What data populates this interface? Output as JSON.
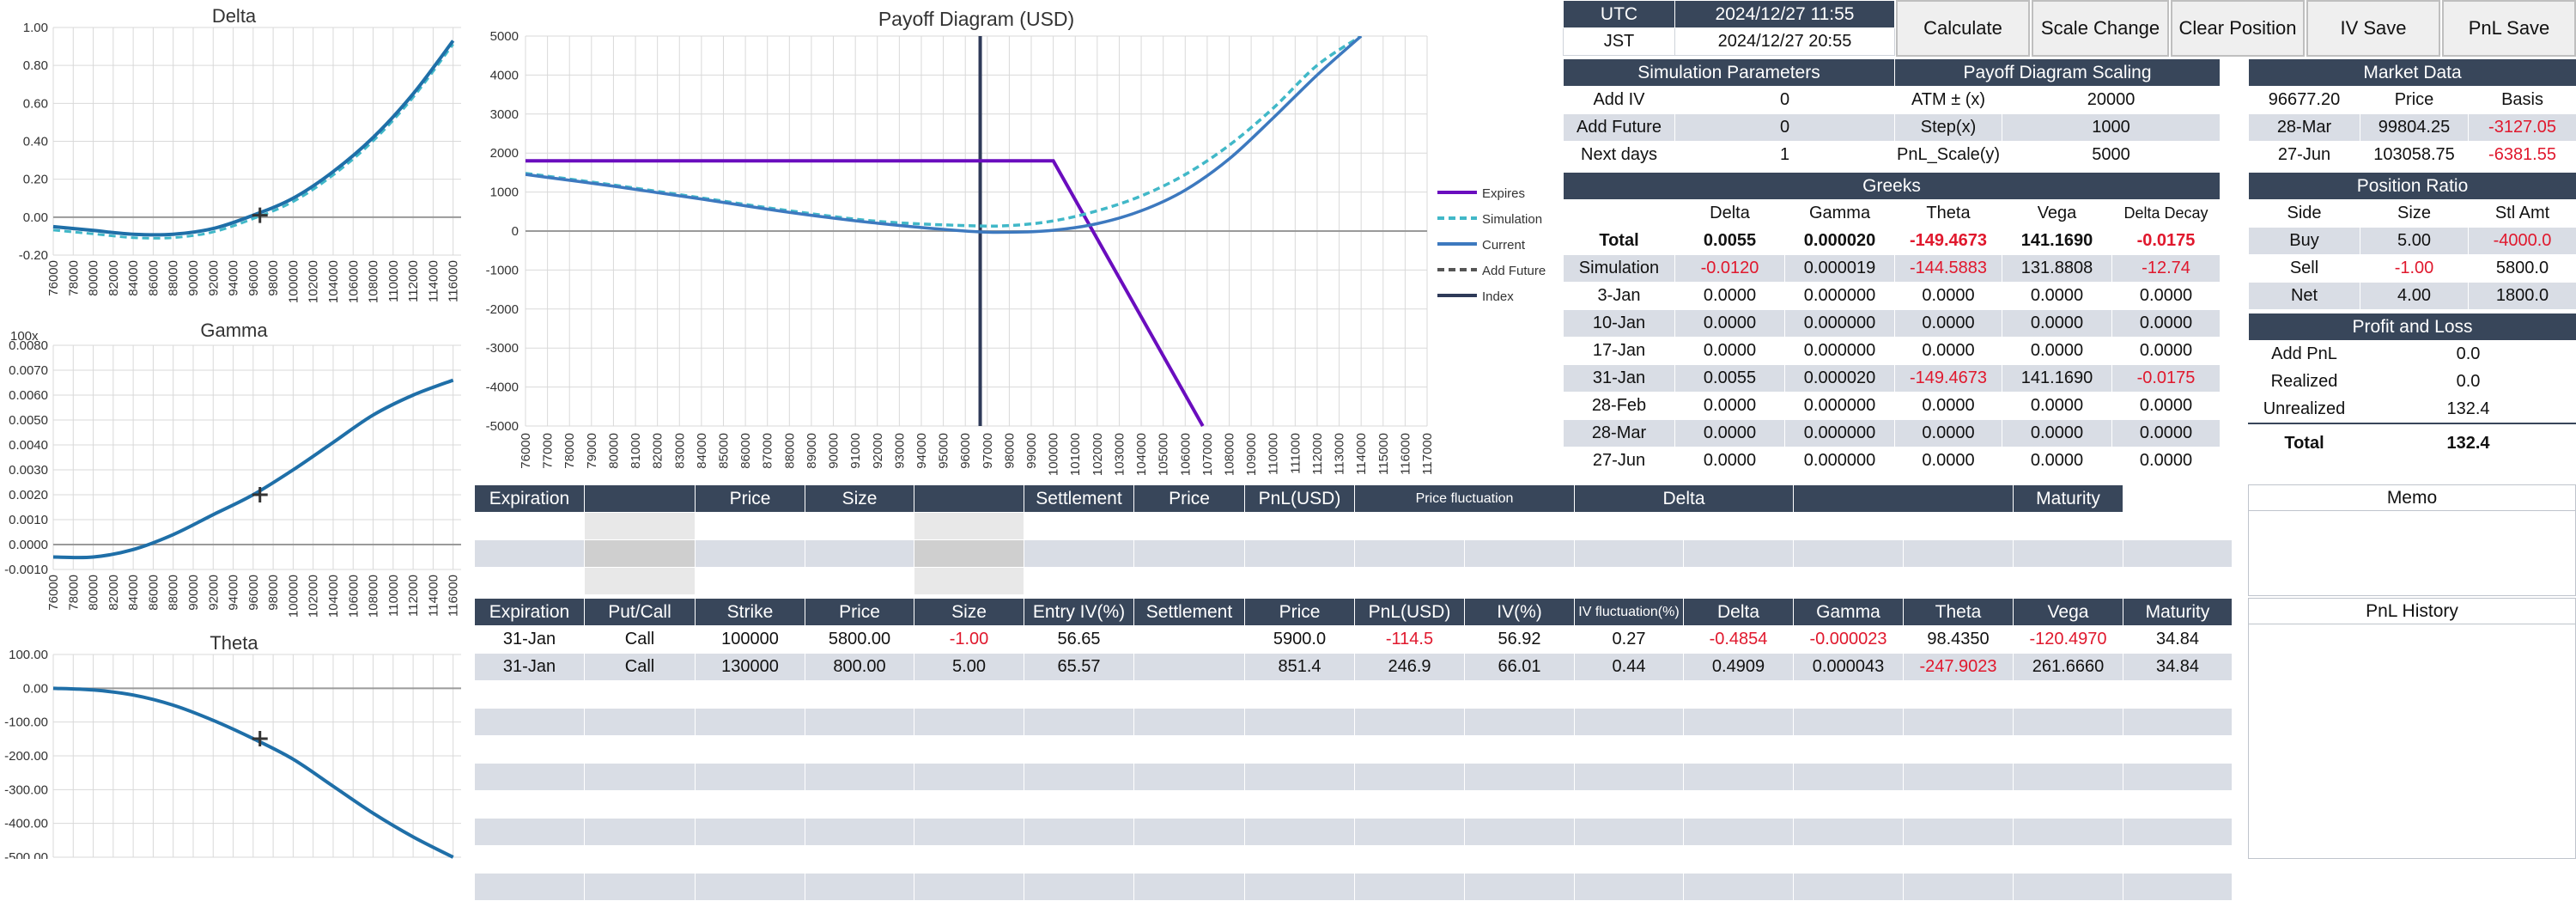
{
  "charts": {
    "delta": {
      "title": "Delta",
      "yticks": [
        "1.00",
        "0.80",
        "0.60",
        "0.40",
        "0.20",
        "0.00",
        "-0.20"
      ]
    },
    "gamma": {
      "title": "Gamma",
      "multiplier": "100x",
      "yticks": [
        "0.0080",
        "0.0070",
        "0.0060",
        "0.0050",
        "0.0040",
        "0.0030",
        "0.0020",
        "0.0010",
        "0.0000",
        "-0.0010"
      ]
    },
    "theta": {
      "title": "Theta",
      "yticks": [
        "100.00",
        "0.00",
        "-100.00",
        "-200.00",
        "-300.00",
        "-400.00",
        "-500.00"
      ]
    },
    "small_xticks": [
      "76000",
      "78000",
      "80000",
      "82000",
      "84000",
      "86000",
      "88000",
      "90000",
      "92000",
      "94000",
      "96000",
      "98000",
      "100000",
      "102000",
      "104000",
      "106000",
      "108000",
      "110000",
      "112000",
      "114000",
      "116000"
    ],
    "payoff": {
      "title": "Payoff Diagram (USD)",
      "yticks": [
        "5000",
        "4000",
        "3000",
        "2000",
        "1000",
        "0",
        "-1000",
        "-2000",
        "-3000",
        "-4000",
        "-5000"
      ],
      "xticks": [
        "76000",
        "77000",
        "78000",
        "79000",
        "80000",
        "81000",
        "82000",
        "83000",
        "84000",
        "85000",
        "86000",
        "87000",
        "88000",
        "89000",
        "90000",
        "91000",
        "92000",
        "93000",
        "94000",
        "95000",
        "96000",
        "97000",
        "98000",
        "99000",
        "100000",
        "101000",
        "102000",
        "103000",
        "104000",
        "105000",
        "106000",
        "107000",
        "108000",
        "109000",
        "110000",
        "111000",
        "112000",
        "113000",
        "114000",
        "115000",
        "116000",
        "117000"
      ],
      "legend": [
        "Expires",
        "Simulation",
        "Current",
        "Add Future",
        "Index"
      ]
    }
  },
  "chart_data": [
    {
      "type": "line",
      "title": "Delta",
      "x": [
        76000,
        80000,
        84000,
        88000,
        92000,
        96000,
        100000,
        104000,
        108000,
        112000,
        116000
      ],
      "series": [
        {
          "values": [
            -0.05,
            -0.07,
            -0.09,
            -0.09,
            -0.06,
            0.01,
            0.1,
            0.24,
            0.42,
            0.65,
            0.93
          ]
        }
      ],
      "ylim": [
        -0.2,
        1.0
      ]
    },
    {
      "type": "line",
      "title": "Gamma",
      "x": [
        76000,
        80000,
        84000,
        88000,
        92000,
        96000,
        100000,
        104000,
        108000,
        112000,
        116000
      ],
      "series": [
        {
          "values": [
            -0.0005,
            -0.0005,
            -0.0002,
            0.0004,
            0.0012,
            0.002,
            0.003,
            0.0041,
            0.0052,
            0.006,
            0.0066
          ]
        }
      ],
      "ylim": [
        -0.001,
        0.008
      ]
    },
    {
      "type": "line",
      "title": "Theta",
      "x": [
        76000,
        80000,
        84000,
        88000,
        92000,
        96000,
        100000,
        104000,
        108000,
        112000,
        116000
      ],
      "series": [
        {
          "values": [
            0,
            -5,
            -20,
            -50,
            -95,
            -149,
            -210,
            -290,
            -370,
            -440,
            -500
          ]
        }
      ],
      "ylim": [
        -500,
        100
      ]
    },
    {
      "type": "line",
      "title": "Payoff Diagram (USD)",
      "x": [
        76000,
        80000,
        84000,
        88000,
        92000,
        96000,
        98000,
        100000,
        102000,
        104000,
        106000,
        108000,
        110000,
        112000,
        114000
      ],
      "series": [
        {
          "name": "Expires",
          "values": [
            1800,
            1800,
            1800,
            1800,
            1800,
            1800,
            1800,
            1800,
            -200,
            -2200,
            -4200,
            null,
            null,
            null,
            null
          ]
        },
        {
          "name": "Simulation",
          "values": [
            1450,
            1150,
            820,
            480,
            200,
            0,
            -30,
            20,
            190,
            520,
            1050,
            1850,
            2900,
            4000,
            5000
          ]
        },
        {
          "name": "Current",
          "values": [
            1480,
            1180,
            850,
            520,
            250,
            140,
            140,
            260,
            520,
            900,
            1450,
            2200,
            3150,
            4250,
            5000
          ]
        }
      ],
      "ylim": [
        -5000,
        5000
      ]
    }
  ],
  "time": {
    "utc_label": "UTC",
    "utc_value": "2024/12/27 11:55",
    "jst_label": "JST",
    "jst_value": "2024/12/27 20:55"
  },
  "buttons": [
    "Calculate",
    "Scale Change",
    "Clear Position",
    "IV Save",
    "PnL Save"
  ],
  "sim_params": {
    "title": "Simulation Parameters",
    "rows": [
      [
        "Add IV",
        "0"
      ],
      [
        "Add Future",
        "0"
      ],
      [
        "Next days",
        "1"
      ]
    ]
  },
  "payoff_scaling": {
    "title": "Payoff Diagram Scaling",
    "rows": [
      [
        "ATM ± (x)",
        "20000"
      ],
      [
        "Step(x)",
        "1000"
      ],
      [
        "PnL_Scale(y)",
        "5000"
      ]
    ]
  },
  "greeks": {
    "title": "Greeks",
    "headers": [
      "",
      "Delta",
      "Gamma",
      "Theta",
      "Vega",
      "Delta Decay"
    ],
    "rows": [
      [
        "Total",
        "0.0055",
        "0.000020",
        "-149.4673",
        "141.1690",
        "-0.0175"
      ],
      [
        "Simulation",
        "-0.0120",
        "0.000019",
        "-144.5883",
        "131.8808",
        "-12.74"
      ],
      [
        "3-Jan",
        "0.0000",
        "0.000000",
        "0.0000",
        "0.0000",
        "0.0000"
      ],
      [
        "10-Jan",
        "0.0000",
        "0.000000",
        "0.0000",
        "0.0000",
        "0.0000"
      ],
      [
        "17-Jan",
        "0.0000",
        "0.000000",
        "0.0000",
        "0.0000",
        "0.0000"
      ],
      [
        "31-Jan",
        "0.0055",
        "0.000020",
        "-149.4673",
        "141.1690",
        "-0.0175"
      ],
      [
        "28-Feb",
        "0.0000",
        "0.000000",
        "0.0000",
        "0.0000",
        "0.0000"
      ],
      [
        "28-Mar",
        "0.0000",
        "0.000000",
        "0.0000",
        "0.0000",
        "0.0000"
      ],
      [
        "27-Jun",
        "0.0000",
        "0.000000",
        "0.0000",
        "0.0000",
        "0.0000"
      ]
    ]
  },
  "market": {
    "title": "Market Data",
    "rows": [
      [
        "96677.20",
        "Price",
        "Basis"
      ],
      [
        "28-Mar",
        "99804.25",
        "-3127.05"
      ],
      [
        "27-Jun",
        "103058.75",
        "-6381.55"
      ]
    ]
  },
  "position_ratio": {
    "title": "Position Ratio",
    "rows": [
      [
        "Side",
        "Size",
        "Stl Amt"
      ],
      [
        "Buy",
        "5.00",
        "-4000.0"
      ],
      [
        "Sell",
        "-1.00",
        "5800.0"
      ],
      [
        "Net",
        "4.00",
        "1800.0"
      ]
    ]
  },
  "pnl": {
    "title": "Profit and Loss",
    "rows": [
      [
        "Add PnL",
        "0.0"
      ],
      [
        "Realized",
        "0.0"
      ],
      [
        "Unrealized",
        "132.4"
      ],
      [
        "Total",
        "132.4"
      ]
    ]
  },
  "memo_title": "Memo",
  "pnl_history_title": "PnL History",
  "futures_table": {
    "headers": [
      "Expiration",
      "",
      "Price",
      "Size",
      "",
      "Settlement",
      "Price",
      "PnL(USD)",
      "Price fluctuation",
      "Delta",
      "",
      "Maturity"
    ]
  },
  "options_table": {
    "headers": [
      "Expiration",
      "Put/Call",
      "Strike",
      "Price",
      "Size",
      "Entry IV(%)",
      "Settlement",
      "Price",
      "PnL(USD)",
      "IV(%)",
      "IV fluctuation(%)",
      "Delta",
      "Gamma",
      "Theta",
      "Vega",
      "Maturity"
    ],
    "rows": [
      [
        "31-Jan",
        "Call",
        "100000",
        "5800.00",
        "-1.00",
        "56.65",
        "",
        "5900.0",
        "-114.5",
        "56.92",
        "0.27",
        "-0.4854",
        "-0.000023",
        "98.4350",
        "-120.4970",
        "34.84"
      ],
      [
        "31-Jan",
        "Call",
        "130000",
        "800.00",
        "5.00",
        "65.57",
        "",
        "851.4",
        "246.9",
        "66.01",
        "0.44",
        "0.4909",
        "0.000043",
        "-247.9023",
        "261.6660",
        "34.84"
      ]
    ]
  }
}
